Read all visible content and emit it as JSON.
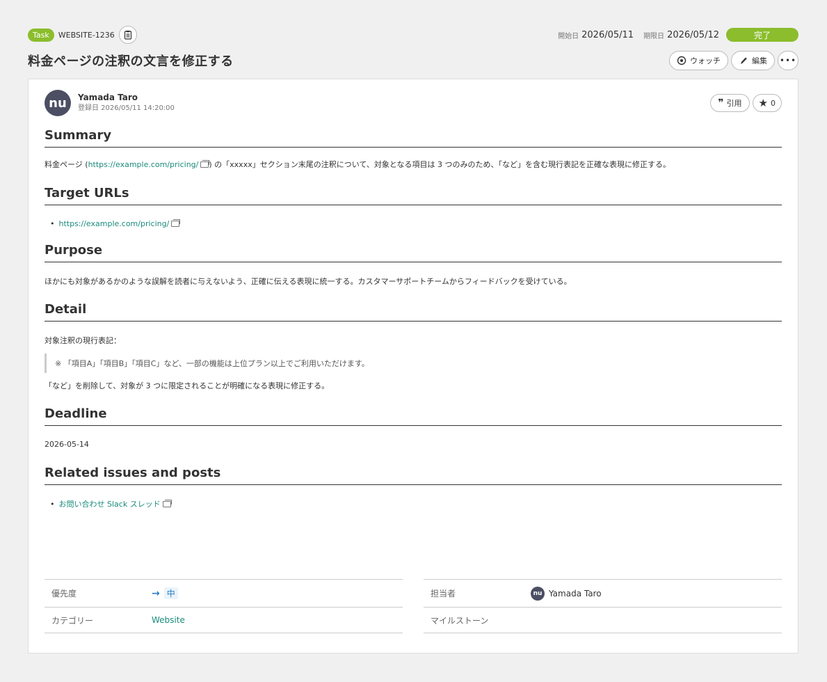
{
  "header": {
    "type_badge": "Task",
    "issue_key": "WEBSITE-1236",
    "start_label": "開始日",
    "start_date": "2026/05/11",
    "due_label": "期限日",
    "due_date": "2026/05/12",
    "status": "完了",
    "status_color": "#8bbd2c",
    "title": "料金ページの注釈の文言を修正する",
    "watch_label": "ウォッチ",
    "edit_label": "編集",
    "more_label": "•••"
  },
  "author": {
    "avatar_text": "nu",
    "name": "Yamada Taro",
    "created": "登録日 2026/05/11 14:20:00",
    "quote_label": "引用",
    "star_count": "0"
  },
  "sections": {
    "summary": {
      "heading": "Summary",
      "text_before": "料金ページ (",
      "link": "https://example.com/pricing/",
      "text_after": ") の「xxxxx」セクション末尾の注釈について、対象となる項目は 3 つのみのため、「など」を含む現行表記を正確な表現に修正する。"
    },
    "target_urls": {
      "heading": "Target URLs",
      "items": [
        "https://example.com/pricing/"
      ]
    },
    "purpose": {
      "heading": "Purpose",
      "text": "ほかにも対象があるかのような誤解を読者に与えないよう、正確に伝える表現に統一する。カスタマーサポートチームからフィードバックを受けている。"
    },
    "detail": {
      "heading": "Detail",
      "intro": "対象注釈の現行表記：",
      "quote": "※ 「項目A」「項目B」「項目C」など、一部の機能は上位プラン以上でご利用いただけます。",
      "outro": "「など」を削除して、対象が 3 つに限定されることが明確になる表現に修正する。"
    },
    "deadline": {
      "heading": "Deadline",
      "text": "2026-05-14"
    },
    "related": {
      "heading": "Related issues and posts",
      "items": [
        "お問い合わせ Slack スレッド"
      ]
    }
  },
  "properties": {
    "priority_label": "優先度",
    "priority_value": "中",
    "category_label": "カテゴリー",
    "category_value": "Website",
    "assignee_label": "担当者",
    "assignee_value": "Yamada Taro",
    "milestone_label": "マイルストーン",
    "milestone_value": ""
  },
  "colors": {
    "accent": "#8bbd2c",
    "link": "#1a8b7a",
    "priority": "#2a7ec6"
  }
}
